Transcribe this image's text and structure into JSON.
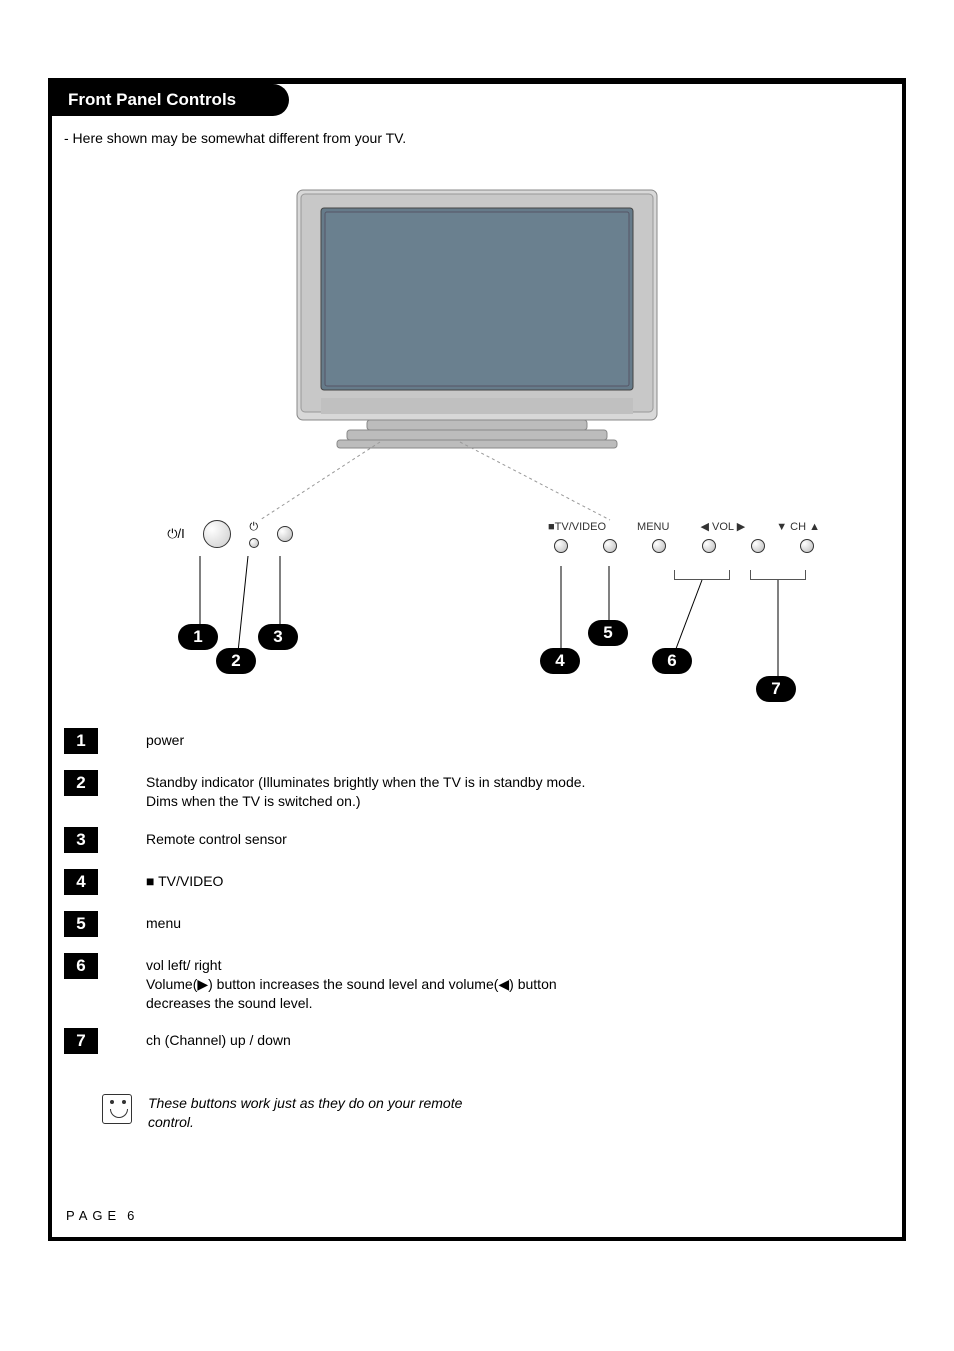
{
  "heading": "Front Panel Controls",
  "intro_note": "- Here shown may be somewhat different from your TV.",
  "panel": {
    "power_symbol": "⏻/I",
    "standby_symbol": "⏻",
    "tv_video_label": "TV/VIDEO",
    "menu_label": "MENU",
    "vol_left": "◀",
    "vol_label": "VOL",
    "vol_right": "▶",
    "ch_down": "▼",
    "ch_label": "CH",
    "ch_up": "▲",
    "stop_square": "■"
  },
  "callouts": {
    "n1": "1",
    "n2": "2",
    "n3": "3",
    "n4": "4",
    "n5": "5",
    "n6": "6",
    "n7": "7"
  },
  "legend": {
    "items": [
      {
        "num": "1",
        "text": "power"
      },
      {
        "num": "2",
        "text": "Standby indicator (Illuminates brightly when the TV is in standby mode. Dims when the TV is switched on.)"
      },
      {
        "num": "3",
        "text": "Remote control sensor"
      },
      {
        "num": "4",
        "text": "■ TV/VIDEO"
      },
      {
        "num": "5",
        "text": "menu"
      },
      {
        "num": "6",
        "text": "vol left/ right\nVolume(▶) button increases the sound level and volume(◀) button decreases the sound level."
      },
      {
        "num": "7",
        "text": "ch (Channel) up / down"
      }
    ]
  },
  "tip_note": "These buttons work just as they do on your remote control.",
  "footer": {
    "page_label": "PAGE",
    "page_number": "6"
  }
}
